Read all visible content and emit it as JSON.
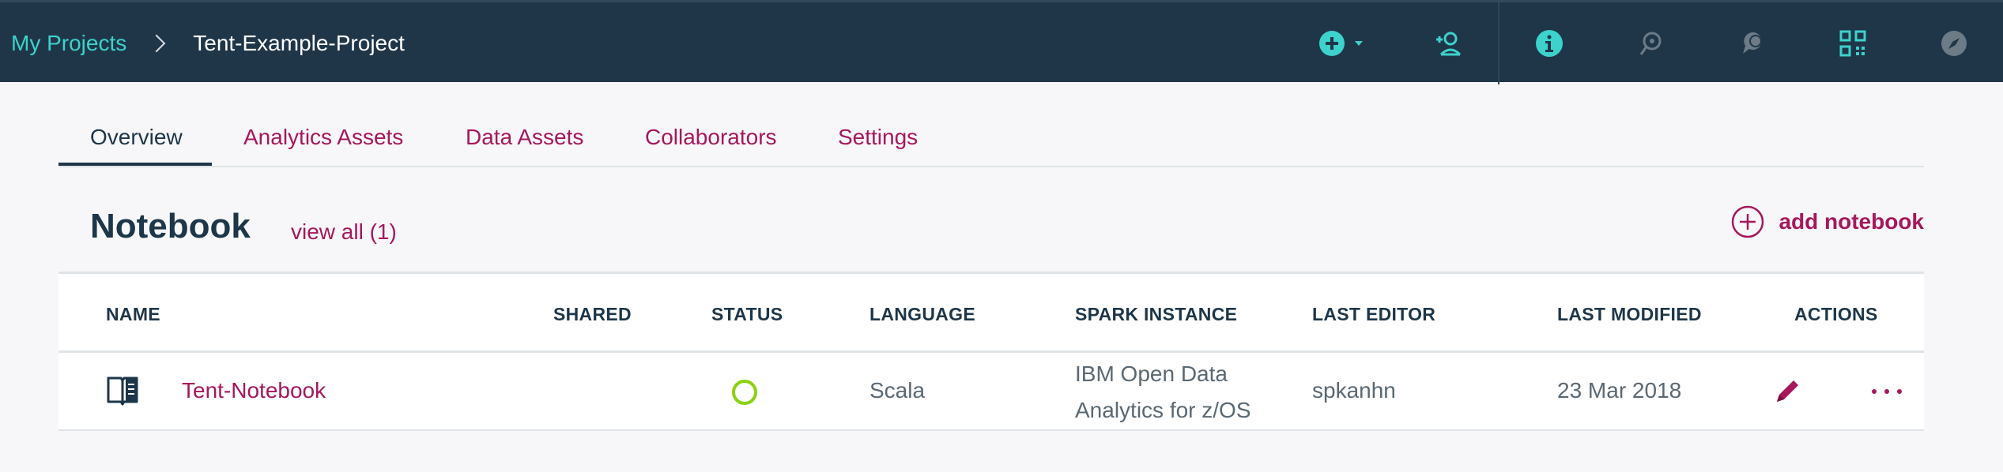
{
  "header": {
    "breadcrumb": {
      "root": "My Projects",
      "current": "Tent-Example-Project"
    },
    "icons": [
      "add-icon",
      "chevron-down-icon",
      "add-collaborator-icon",
      "info-icon",
      "history-icon",
      "comments-icon",
      "data-icon",
      "compass-icon"
    ],
    "accent_color": "#3dd2cc",
    "background_color": "#1f3649"
  },
  "tabs": [
    {
      "label": "Overview",
      "active": true
    },
    {
      "label": "Analytics Assets",
      "active": false
    },
    {
      "label": "Data Assets",
      "active": false
    },
    {
      "label": "Collaborators",
      "active": false
    },
    {
      "label": "Settings",
      "active": false
    }
  ],
  "notebook_section": {
    "title": "Notebook",
    "view_all": "view all (1)",
    "add_label": "add notebook"
  },
  "table": {
    "columns": [
      "NAME",
      "SHARED",
      "STATUS",
      "LANGUAGE",
      "SPARK INSTANCE",
      "LAST EDITOR",
      "LAST MODIFIED",
      "ACTIONS"
    ],
    "rows": [
      {
        "name": "Tent-Notebook",
        "shared": "",
        "status": "ready",
        "language": "Scala",
        "spark_line1": "IBM Open Data",
        "spark_line2": "Analytics for z/OS",
        "last_editor": "spkanhn",
        "last_modified": "23 Mar 2018"
      }
    ]
  },
  "colors": {
    "link": "#a6175c",
    "text": "#1d3649",
    "status_ok": "#8cd211"
  }
}
